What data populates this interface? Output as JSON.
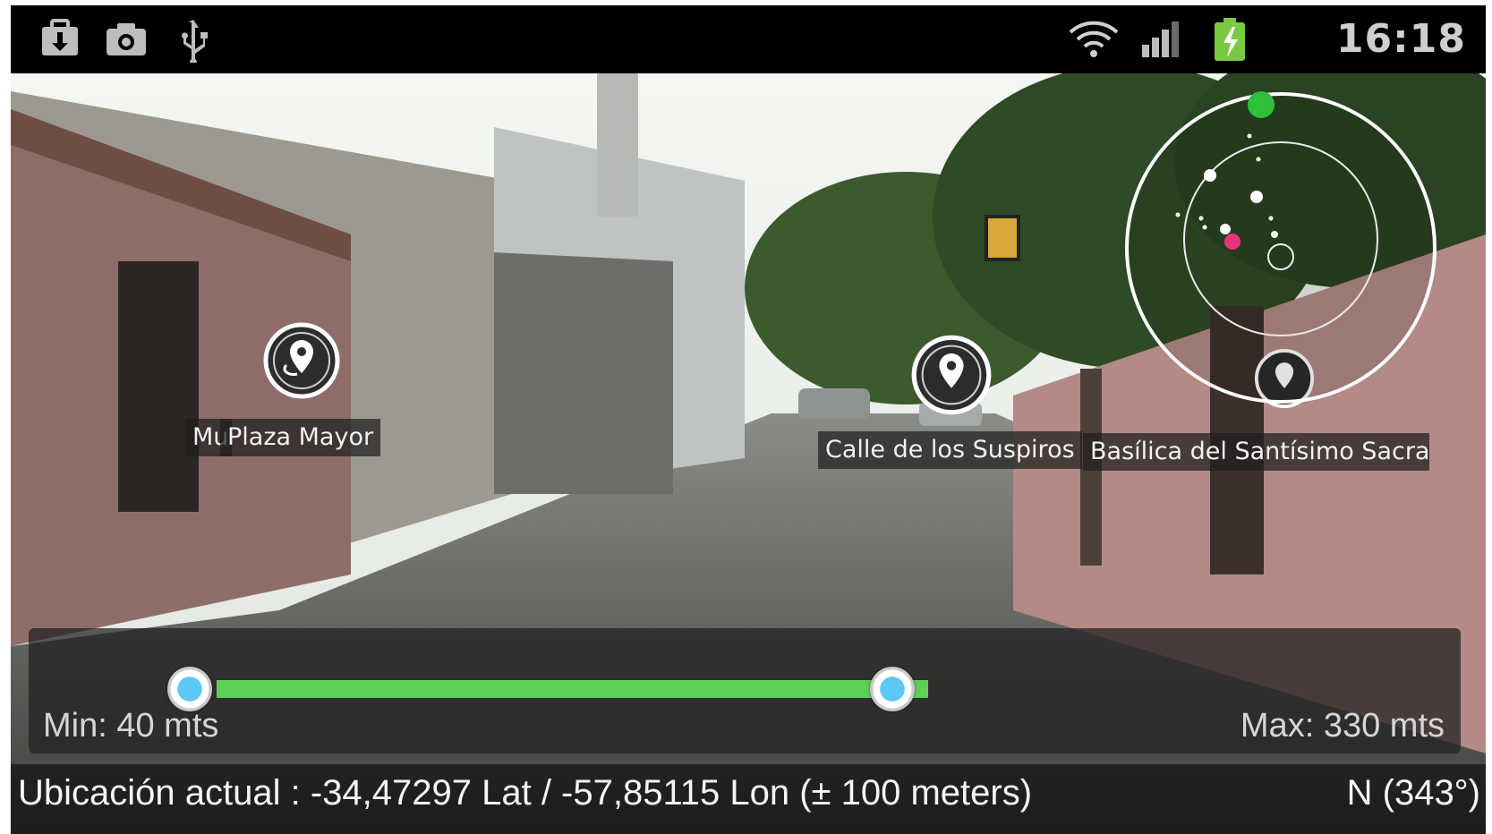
{
  "status_bar": {
    "time": "16:18",
    "icons": [
      "download-icon",
      "camera-icon",
      "usb-icon",
      "wifi-icon",
      "signal-icon",
      "battery-charging-icon"
    ],
    "battery_color": "#7ac943"
  },
  "pois": [
    {
      "label": "Plaza Mayor",
      "icon": "map-pin-icon"
    },
    {
      "label": "Mu",
      "icon": "map-pin-icon"
    },
    {
      "label": "Calle de los Suspiros",
      "icon": "map-pin-icon"
    },
    {
      "label": "Basílica del Santísimo Sacra",
      "icon": "map-pin-icon"
    }
  ],
  "radar": {
    "ring_color": "#ffffff",
    "heading_dot_color": "#2fbf3a",
    "self_dot_color": "#e8327a"
  },
  "range": {
    "min_label": "Min: 40 mts",
    "max_label": "Max: 330 mts",
    "track_color": "#5fcf59",
    "thumb_color": "#5cc8f5"
  },
  "location": {
    "text": "Ubicación actual : -34,47297 Lat / -57,85115 Lon (± 100 meters)",
    "heading": "N (343°)"
  }
}
